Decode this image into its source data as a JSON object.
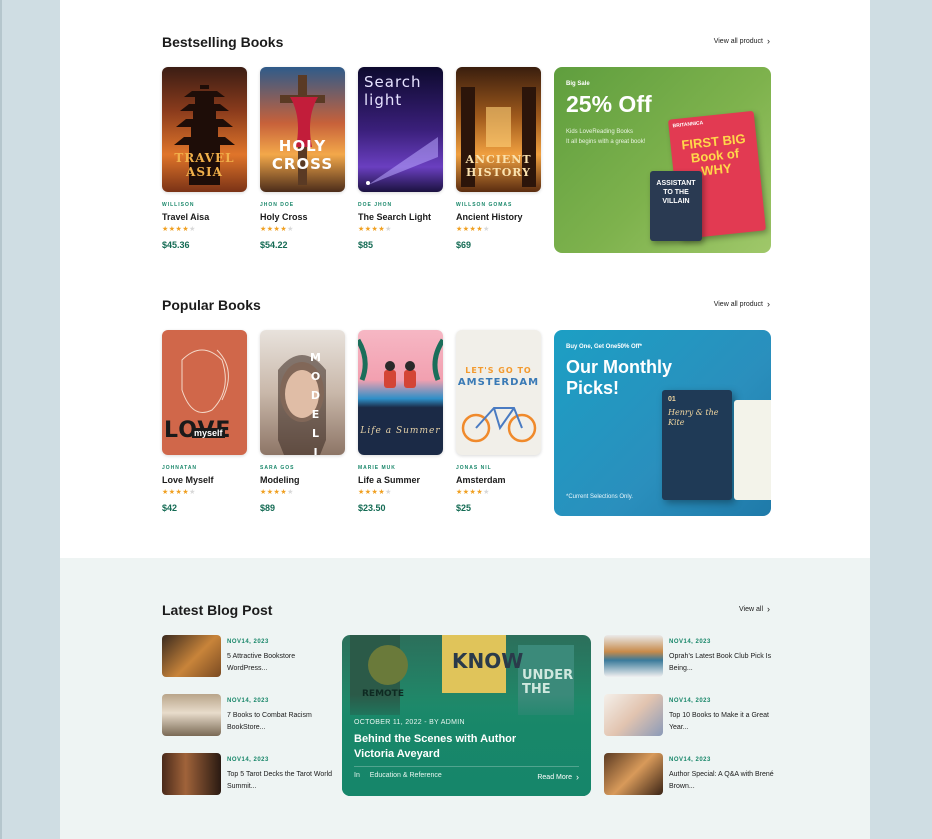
{
  "bestselling": {
    "title": "Bestselling Books",
    "view_all": "View all product",
    "books": [
      {
        "author": "WILLISON",
        "title": "Travel Aisa",
        "price": "$45.36",
        "rating": 4,
        "cover_text": "TRAVEL ASIA"
      },
      {
        "author": "JHON DOE",
        "title": "Holy Cross",
        "price": "$54.22",
        "rating": 4,
        "cover_text": "HOLY CROSS"
      },
      {
        "author": "DOE JHON",
        "title": "The Search Light",
        "price": "$85",
        "rating": 4,
        "cover_text": "Search light"
      },
      {
        "author": "WILLSON GOMAS",
        "title": "Ancient History",
        "price": "$69",
        "rating": 4,
        "cover_text": "ANCIENT HISTORY"
      }
    ],
    "promo": {
      "tag": "Big Sale",
      "headline": "25% Off",
      "line1": "Kids LoveReading Books",
      "line2": "It all begins with a great book!",
      "book1": "FIRST BIG Book of WHY",
      "book2": "ASSISTANT TO THE VILLAIN",
      "brand": "BRITANNICA"
    }
  },
  "popular": {
    "title": "Popular Books",
    "view_all": "View all product",
    "books": [
      {
        "author": "JOHNATAN",
        "title": "Love Myself",
        "price": "$42",
        "rating": 4,
        "cover_text": "LOVE",
        "cover_text2": "myself"
      },
      {
        "author": "SARA GOS",
        "title": "Modeling",
        "price": "$89",
        "rating": 4,
        "cover_text": "MODELING"
      },
      {
        "author": "MARIE MUK",
        "title": "Life a Summer",
        "price": "$23.50",
        "rating": 4,
        "cover_text": "Life a Summer"
      },
      {
        "author": "JONAS NIL",
        "title": "Amsterdam",
        "price": "$25",
        "rating": 4,
        "cover_text": "LET'S GO TO",
        "cover_text2": "AMSTERDAM"
      }
    ],
    "promo": {
      "tag": "Buy One, Get One50% Off*",
      "headline_line1": "Our Monthly",
      "headline_line2": "Picks!",
      "foot": "*Current Selections Only.",
      "book1": "Henry & the Kite",
      "book_number": "01"
    }
  },
  "blog": {
    "title": "Latest Blog Post",
    "view_all": "View all",
    "left": [
      {
        "date": "NOV14, 2023",
        "text": "5 Attractive Bookstore WordPress..."
      },
      {
        "date": "NOV14, 2023",
        "text": "7 Books to Combat Racism BookStore..."
      },
      {
        "date": "NOV14, 2023",
        "text": "Top 5 Tarot Decks the Tarot World Summit..."
      }
    ],
    "right": [
      {
        "date": "NOV14, 2023",
        "text": "Oprah's Latest Book Club Pick Is Being..."
      },
      {
        "date": "NOV14, 2023",
        "text": "Top 10 Books to Make it a Great Year..."
      },
      {
        "date": "NOV14, 2023",
        "text": "Author Special: A Q&A with Brené Brown..."
      }
    ],
    "feature": {
      "meta": "OCTOBER 11, 2022 - BY ADMIN",
      "title": "Behind the Scenes with Author Victoria Aveyard",
      "category_prefix": "In",
      "category": "Education & Reference",
      "read_more": "Read More",
      "cover_words": [
        "KNOW",
        "REMOTE",
        "UNDER THE"
      ]
    }
  },
  "colors": {
    "accent_green": "#19876a",
    "price_green": "#146b54",
    "star": "#f0a022",
    "promo_green": "#6ea845",
    "promo_blue": "#1f93c1",
    "blog_bg": "#eef4f3"
  }
}
